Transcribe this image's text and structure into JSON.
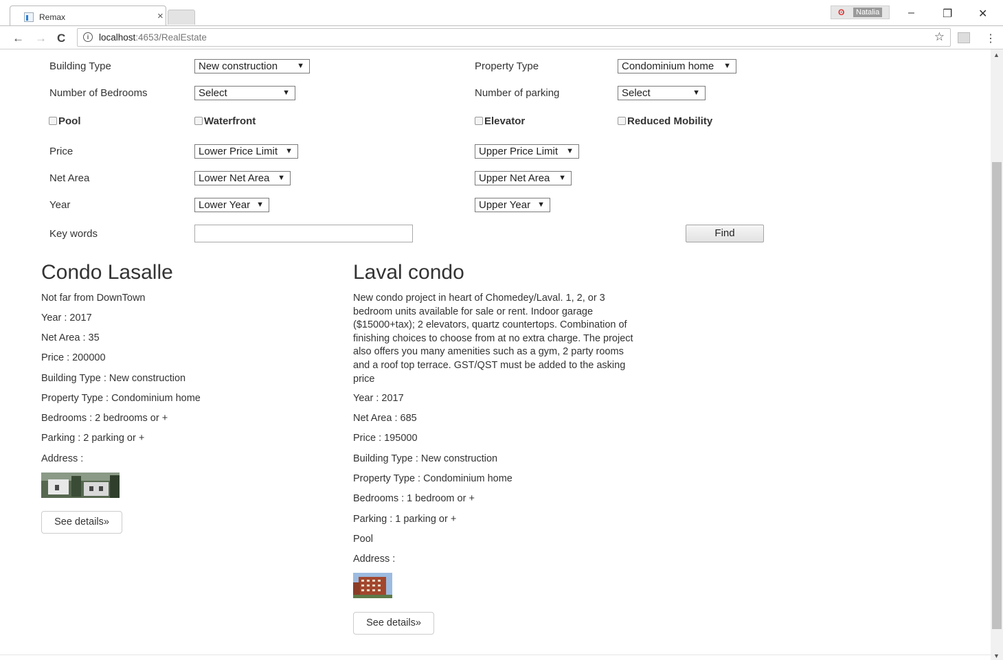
{
  "browser": {
    "tab_title": "Remax",
    "tab_close": "×",
    "profile_name": "Natalia",
    "url_host": "localhost",
    "url_path": ":4653/RealEstate",
    "minimize": "–",
    "restore": "❐",
    "close": "✕",
    "back": "←",
    "forward": "→",
    "reload": "C",
    "star": "☆",
    "menu": "⋮",
    "info": "i"
  },
  "search": {
    "building_type": {
      "label": "Building Type",
      "value": "New construction"
    },
    "property_type": {
      "label": "Property Type",
      "value": "Condominium home"
    },
    "bedrooms": {
      "label": "Number of Bedrooms",
      "value": "Select"
    },
    "parking": {
      "label": "Number of parking",
      "value": "Select"
    },
    "checkboxes": [
      "Pool",
      "Waterfront",
      "Elevator",
      "Reduced Mobility"
    ],
    "price": {
      "label": "Price",
      "lower": "Lower Price Limit",
      "upper": "Upper Price Limit"
    },
    "net_area": {
      "label": "Net Area",
      "lower": "Lower Net Area",
      "upper": "Upper Net Area"
    },
    "year": {
      "label": "Year",
      "lower": "Lower Year",
      "upper": "Upper Year"
    },
    "keywords": {
      "label": "Key words",
      "value": ""
    },
    "find_label": "Find"
  },
  "listings": [
    {
      "title": "Condo Lasalle",
      "description": "Not far from DownTown",
      "year": "Year : 2017",
      "net_area": "Net Area : 35",
      "price": "Price : 200000",
      "building_type": "Building Type : New construction",
      "property_type": "Property Type : Condominium home",
      "bedrooms": "Bedrooms : 2 bedrooms or +",
      "parking": "Parking : 2 parking or +",
      "address": "Address :",
      "details_label": "See details»"
    },
    {
      "title": "Laval condo",
      "description": "New condo project in heart of Chomedey/Laval. 1, 2, or 3 bedroom units available for sale or rent. Indoor garage ($15000+tax); 2 elevators, quartz countertops. Combination of finishing choices to choose from at no extra charge. The project also offers you many amenities such as a gym, 2 party rooms and a roof top terrace. GST/QST must be added to the asking price",
      "year": "Year : 2017",
      "net_area": "Net Area : 685",
      "price": "Price : 195000",
      "building_type": "Building Type : New construction",
      "property_type": "Property Type : Condominium home",
      "bedrooms": "Bedrooms : 1 bedroom or +",
      "parking": "Parking : 1 parking or +",
      "feature": "Pool",
      "address": "Address :",
      "details_label": "See details»"
    }
  ],
  "dropdown_arrow": "▼",
  "scroll_up": "▲",
  "scroll_down": "▼"
}
